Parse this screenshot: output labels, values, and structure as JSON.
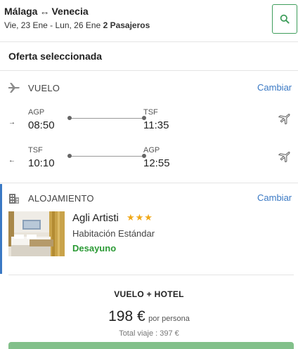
{
  "header": {
    "origin": "Málaga",
    "arrow": "↔",
    "destination": "Venecia",
    "dates": "Vie, 23 Ene - Lun, 26 Ene",
    "passengers": "2 Pasajeros",
    "search_icon": "search-icon"
  },
  "offer": {
    "title": "Oferta seleccionada"
  },
  "flight": {
    "label": "VUELO",
    "change": "Cambiar",
    "icon": "plane-icon",
    "legs": [
      {
        "direction_icon": "arrow-right-icon",
        "direction": "→",
        "from_code": "AGP",
        "from_time": "08:50",
        "to_code": "TSF",
        "to_time": "11:35",
        "airline_icon": "airline-plane-icon"
      },
      {
        "direction_icon": "arrow-left-icon",
        "direction": "←",
        "from_code": "TSF",
        "from_time": "10:10",
        "to_code": "AGP",
        "to_time": "12:55",
        "airline_icon": "airline-plane-icon"
      }
    ]
  },
  "accommodation": {
    "label": "ALOJAMIENTO",
    "change": "Cambiar",
    "icon": "building-icon",
    "hotel_name": "Agli Artisti",
    "stars": "★★★",
    "star_count": 3,
    "room": "Habitación Estándar",
    "meal": "Desayuno",
    "colors": {
      "accent": "#3a79c4",
      "meal": "#2b9a35",
      "stars": "#f0a818"
    }
  },
  "package": {
    "label": "VUELO + HOTEL",
    "price": "198 €",
    "per_person": "por persona",
    "total": "Total viaje : 397 €"
  },
  "colors": {
    "primary_green": "#3f9e5c",
    "link_blue": "#3a79c4"
  }
}
